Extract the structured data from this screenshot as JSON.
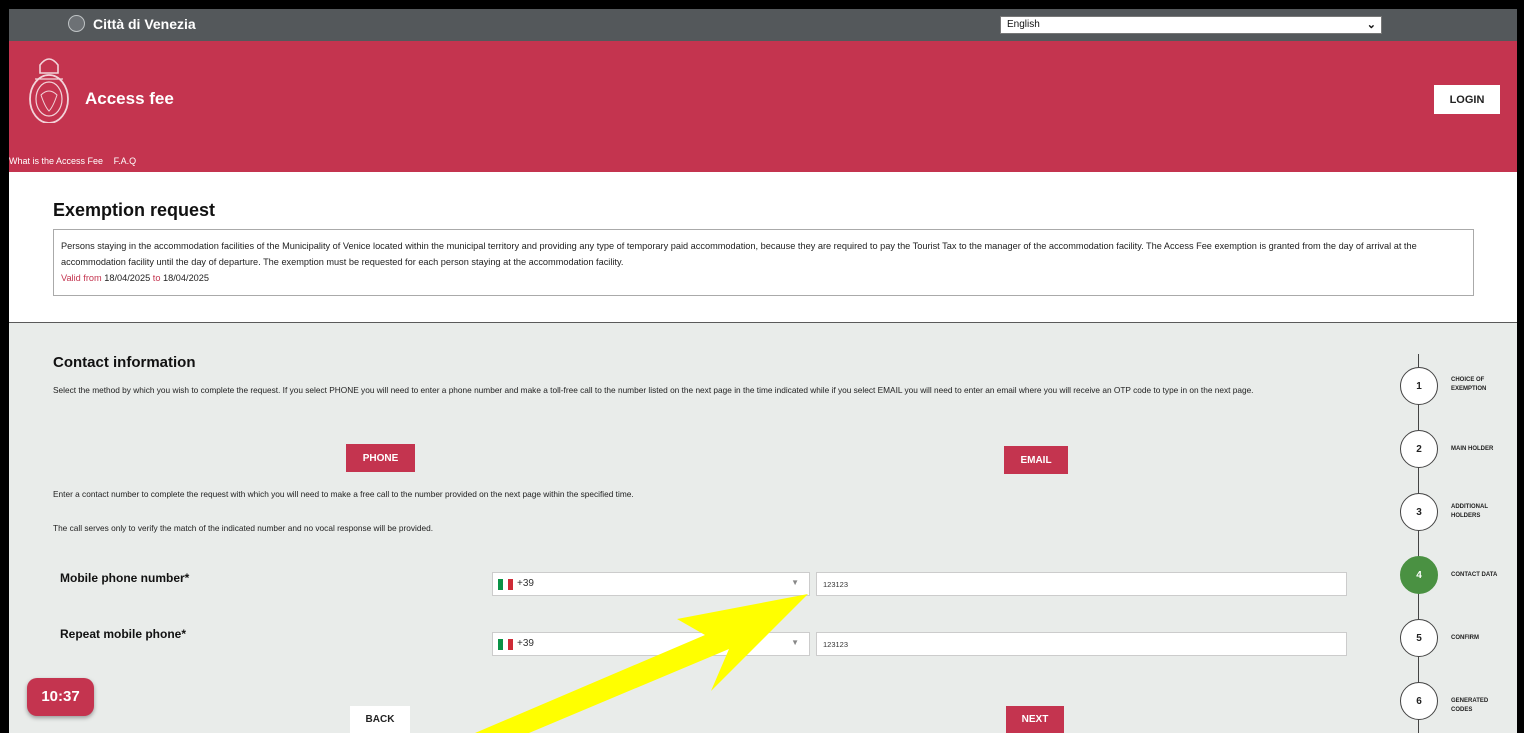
{
  "topbar": {
    "city_name": "Città di Venezia",
    "language": "English"
  },
  "header": {
    "title": "Access fee",
    "login_label": "LOGIN",
    "nav": [
      "What is the Access Fee",
      "F.A.Q"
    ]
  },
  "exemption": {
    "title": "Exemption request",
    "description": "Persons staying in the accommodation facilities of the Municipality of Venice located within the municipal territory and providing any type of temporary paid accommodation, because they are required to pay the Tourist Tax to the manager of the accommodation facility. The Access Fee exemption is granted from the day of arrival at the accommodation facility until the day of departure. The exemption must be requested for each person staying at the accommodation facility.",
    "valid_from_label": "Valid from",
    "valid_from": "18/04/2025",
    "valid_to_label": "to",
    "valid_to": "18/04/2025"
  },
  "contact": {
    "title": "Contact information",
    "description": "Select the method by which you wish to complete the request. If you select PHONE you will need to enter a phone number and make a toll-free call to the number listed on the next page in the time indicated while if you select EMAIL you will need to enter an email where you will receive an OTP code to type in on the next page.",
    "phone_button": "PHONE",
    "email_button": "EMAIL",
    "helper_1": "Enter a contact number to complete the request with which you will need to make a free call to the number provided on the next page within the specified time.",
    "helper_2": "The call serves only to verify the match of the indicated number and no vocal response will be provided.",
    "mobile_label": "Mobile phone number*",
    "repeat_label": "Repeat mobile phone*",
    "country_code": "+39",
    "mobile_value": "123123",
    "repeat_value": "123123",
    "back_label": "BACK",
    "next_label": "NEXT"
  },
  "timer": "10:37",
  "steps": [
    {
      "number": "1",
      "label": "CHOICE OF EXEMPTION"
    },
    {
      "number": "2",
      "label": "MAIN HOLDER"
    },
    {
      "number": "3",
      "label": "ADDITIONAL HOLDERS"
    },
    {
      "number": "4",
      "label": "CONTACT DATA",
      "active": true
    },
    {
      "number": "5",
      "label": "CONFIRM"
    },
    {
      "number": "6",
      "label": "GENERATED CODES"
    }
  ],
  "colors": {
    "brand": "#c4344f",
    "active_step": "#4a9142",
    "annotation_arrow": "#ffff00"
  }
}
